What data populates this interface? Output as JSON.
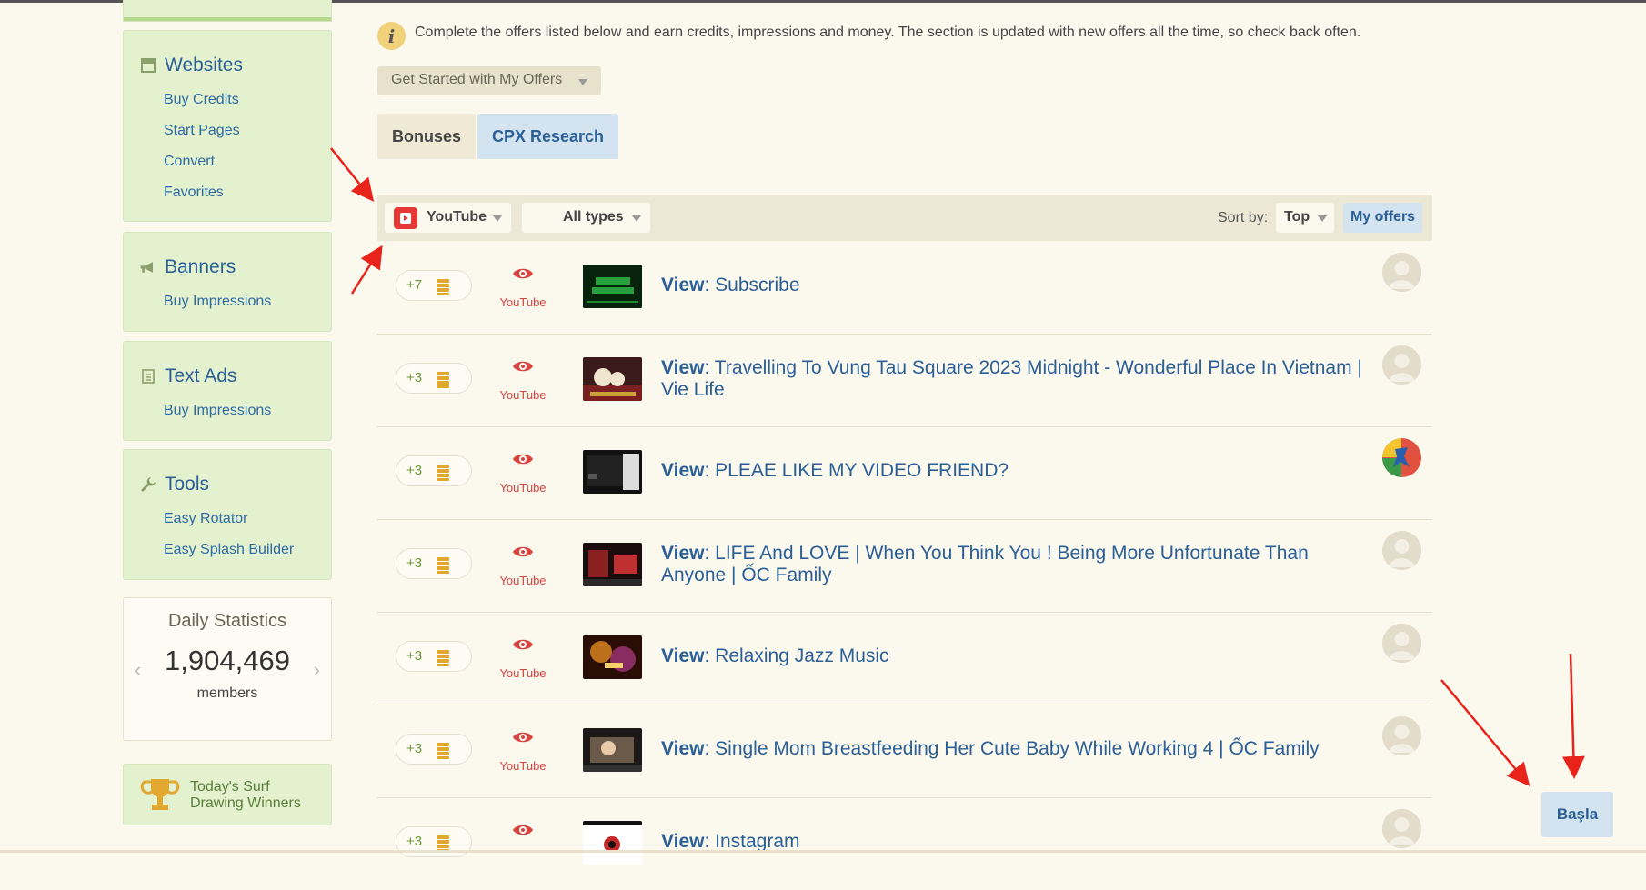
{
  "info": {
    "text": "Complete the offers listed below and earn credits, impressions and money. The section is updated with new offers all the time, so check back often.",
    "icon_glyph": "i"
  },
  "offers_dropdown": {
    "label": "Get Started with My Offers"
  },
  "tabs": [
    {
      "label": "Bonuses",
      "active": false
    },
    {
      "label": "CPX Research",
      "active": true
    }
  ],
  "filters": {
    "platform": "YouTube",
    "type": "All types",
    "sort_label": "Sort by:",
    "sort_value": "Top",
    "my_offers": "My offers"
  },
  "sidebar": {
    "sections": [
      {
        "title": "Websites",
        "icon": "window-icon",
        "items": [
          "Buy Credits",
          "Start Pages",
          "Convert",
          "Favorites"
        ]
      },
      {
        "title": "Banners",
        "icon": "megaphone-icon",
        "items": [
          "Buy Impressions"
        ]
      },
      {
        "title": "Text Ads",
        "icon": "document-icon",
        "items": [
          "Buy Impressions"
        ]
      },
      {
        "title": "Tools",
        "icon": "wrench-icon",
        "items": [
          "Easy Rotator",
          "Easy Splash Builder"
        ]
      }
    ],
    "stats": {
      "title": "Daily Statistics",
      "number": "1,904,469",
      "unit": "members"
    },
    "winners": {
      "line1": "Today's Surf",
      "line2": "Drawing Winners"
    }
  },
  "offers": [
    {
      "credits": "+7",
      "source": "YouTube",
      "action": "View",
      "title": "Subscribe"
    },
    {
      "credits": "+3",
      "source": "YouTube",
      "action": "View",
      "title": "Travelling To Vung Tau Square 2023 Midnight - Wonderful Place In Vietnam | Vie Life"
    },
    {
      "credits": "+3",
      "source": "YouTube",
      "action": "View",
      "title": "PLEAE LIKE MY VIDEO FRIEND?"
    },
    {
      "credits": "+3",
      "source": "YouTube",
      "action": "View",
      "title": "LIFE And LOVE | When You Think You ! Being More Unfortunate Than Anyone | ỐC Family"
    },
    {
      "credits": "+3",
      "source": "YouTube",
      "action": "View",
      "title": "Relaxing Jazz Music"
    },
    {
      "credits": "+3",
      "source": "YouTube",
      "action": "View",
      "title": "Single Mom Breastfeeding Her Cute Baby While Working 4 | ỐC Family"
    },
    {
      "credits": "+3",
      "source": "",
      "action": "View",
      "title": "Instagram"
    }
  ],
  "start_button": "Başla",
  "colors": {
    "link": "#2b5f95",
    "sidebar_bg": "#e3f1cf",
    "credit_green": "#6a9a3a",
    "youtube_red": "#e53935",
    "annotation_red": "#e8231a"
  }
}
